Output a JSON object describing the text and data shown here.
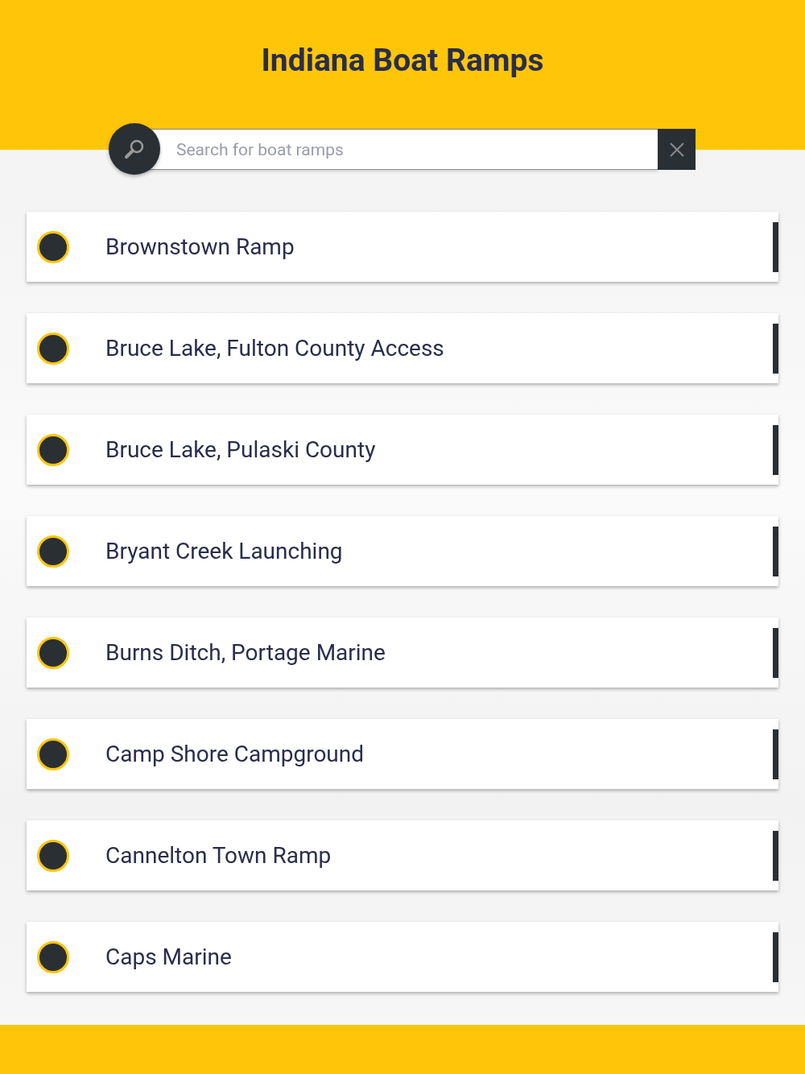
{
  "title": "Indiana Boat Ramps",
  "search": {
    "placeholder": "Search for boat ramps"
  },
  "ramps": [
    {
      "name": "Brownstown Ramp"
    },
    {
      "name": "Bruce Lake, Fulton County Access"
    },
    {
      "name": "Bruce Lake, Pulaski County"
    },
    {
      "name": "Bryant Creek Launching"
    },
    {
      "name": "Burns Ditch, Portage Marine"
    },
    {
      "name": "Camp Shore Campground"
    },
    {
      "name": "Cannelton Town Ramp"
    },
    {
      "name": "Caps Marine"
    }
  ]
}
